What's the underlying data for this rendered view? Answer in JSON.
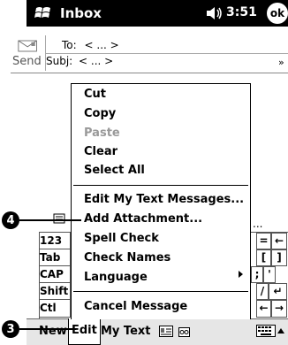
{
  "titlebar": {
    "title": "Inbox",
    "time": "3:51",
    "ok_label": "ok"
  },
  "header": {
    "send_label": "Send",
    "to_label": "To:",
    "to_value": "< ... >",
    "subj_label": "Subj:",
    "subj_value": "< ... >"
  },
  "background_dots": "...",
  "keyboard": {
    "left_keys": [
      "123",
      "Tab",
      "CAP",
      "Shift",
      "Ctl"
    ],
    "right_keys": [
      [
        "=",
        "←"
      ],
      [
        "[",
        "]"
      ],
      [
        ";",
        "'"
      ],
      [
        "/",
        "↵"
      ],
      [
        "←",
        "→"
      ]
    ]
  },
  "menu": {
    "items": [
      {
        "label": "Cut",
        "enabled": true
      },
      {
        "label": "Copy",
        "enabled": true
      },
      {
        "label": "Paste",
        "enabled": false
      },
      {
        "label": "Clear",
        "enabled": true
      },
      {
        "label": "Select All",
        "enabled": true
      },
      {
        "label": "Edit My Text Messages...",
        "enabled": true
      },
      {
        "label": "Add Attachment...",
        "enabled": true
      },
      {
        "label": "Spell Check",
        "enabled": true
      },
      {
        "label": "Check Names",
        "enabled": true
      },
      {
        "label": "Language",
        "enabled": true,
        "has_submenu": true
      },
      {
        "label": "Cancel Message",
        "enabled": true
      }
    ]
  },
  "commandbar": {
    "new_label": "New",
    "edit_label": "Edit",
    "mytext_label": "My Text"
  },
  "callouts": {
    "attachment_callout": "4",
    "edit_callout": "3"
  },
  "icons": {
    "start": "windows-flag-icon",
    "speaker": "speaker-icon",
    "send": "envelope-send-icon",
    "expand": "chevron-down-icon",
    "attachment": "paperclip-icon",
    "submenu": "triangle-right-icon",
    "cmd_address": "address-card-icon",
    "cmd_recorder": "recorder-icon",
    "cmd_keyboard": "keyboard-icon"
  }
}
